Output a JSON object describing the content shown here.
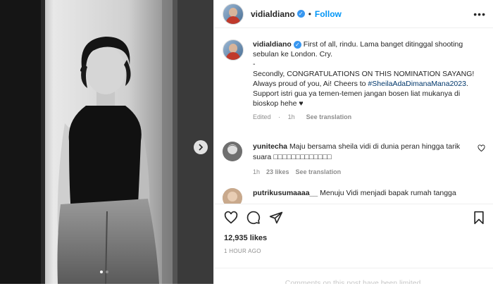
{
  "header": {
    "username": "vidialdiano",
    "separator": "•",
    "follow_label": "Follow",
    "more_label": "•••"
  },
  "caption": {
    "username": "vidialdiano",
    "line1": "First of all, rindu. Lama banget ditinggal shooting sebulan ke London. Cry.",
    "dash": "-",
    "line2_before": "Secondly, CONGRATULATIONS ON THIS NOMINATION SAYANG! Always proud of you, Ai! Cheers to ",
    "hashtag": "#SheilaAdaDimanaMana2023",
    "line2_after": ". Support istri gua ya temen-temen jangan bosen liat mukanya di bioskop hehe",
    "heart": "♥",
    "edited": "Edited",
    "edited_sep": "·",
    "time": "1h",
    "see_translation": "See translation"
  },
  "comments": [
    {
      "username": "yunitecha",
      "text": "Maju bersama sheila vidi di dunia peran hingga tarik suara",
      "tofu": "□□□□□□□□□□□□□",
      "time": "1h",
      "likes": "23 likes",
      "see_translation": "See translation"
    },
    {
      "username": "putrikusumaaaa__",
      "text": "Menuju Vidi menjadi bapak rumah tangga"
    }
  ],
  "actions": {
    "icons": [
      "heart-icon",
      "comment-icon",
      "share-icon",
      "bookmark-icon"
    ],
    "likes": "12,935 likes",
    "posted": "1 HOUR AGO"
  },
  "footer": {
    "limited": "Comments on this post have been limited."
  },
  "colors": {
    "link_blue": "#0095f6",
    "hashtag": "#00376b",
    "verified": "#3897f0",
    "muted": "#8e8e8e"
  },
  "carousel": {
    "slides": 2,
    "active_slide": 1
  }
}
